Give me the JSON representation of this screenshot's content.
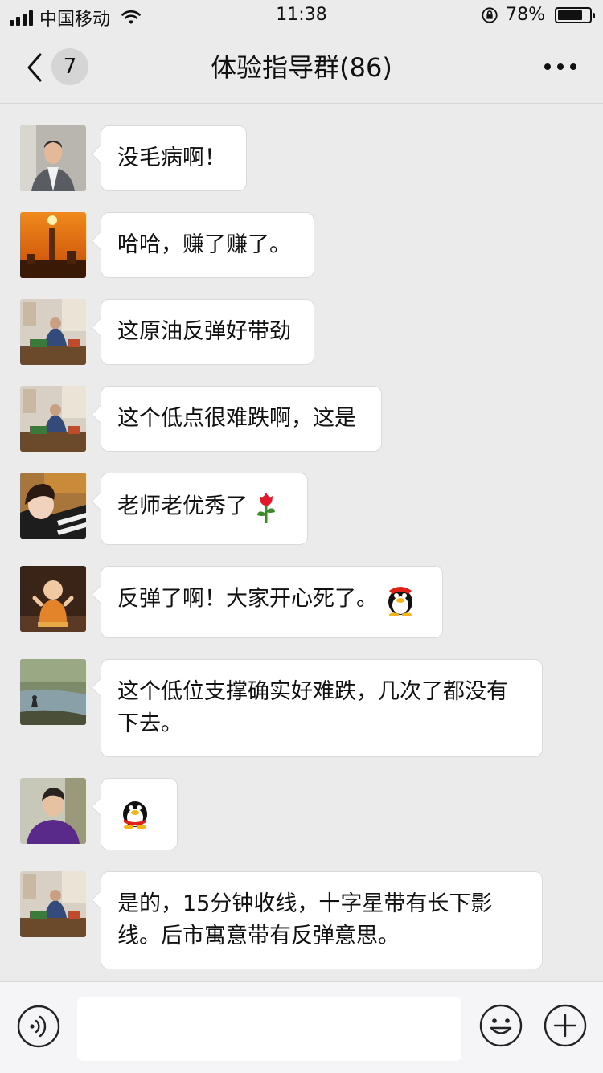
{
  "status_bar": {
    "carrier": "中国移动",
    "time": "11:38",
    "battery_percent": "78%",
    "battery_level": 0.78
  },
  "nav": {
    "back_icon": "chevron-left-icon",
    "unread_count": "7",
    "title": "体验指导群(86)",
    "more_icon": "more-dots-icon"
  },
  "messages": [
    {
      "text": "没毛病啊！",
      "avatar": "man-portrait"
    },
    {
      "text": "哈哈，赚了赚了。",
      "avatar": "sunset-city"
    },
    {
      "text": "这原油反弹好带劲",
      "avatar": "man-at-desk"
    },
    {
      "text": "这个低点很难跌啊，这是",
      "avatar": "man-at-desk"
    },
    {
      "text": "老师老优秀了",
      "avatar": "girl-portrait",
      "emoji": "rose-emoji"
    },
    {
      "text": "反弹了啊！大家开心死了。",
      "avatar": "monk-figurine",
      "emoji": "penguin-emoji"
    },
    {
      "text": "这个低位支撑确实好难跌，几次了都没有下去。",
      "avatar": "river-scene"
    },
    {
      "text": "",
      "avatar": "man-purple-jacket",
      "emoji": "penguin-emoji"
    },
    {
      "text": "是的，15分钟收线，十字星带有长下影线。后市寓意带有反弹意思。",
      "avatar": "man-at-desk"
    }
  ],
  "input_bar": {
    "voice_icon": "voice-icon",
    "emoji_icon": "smiley-icon",
    "plus_icon": "plus-icon"
  }
}
